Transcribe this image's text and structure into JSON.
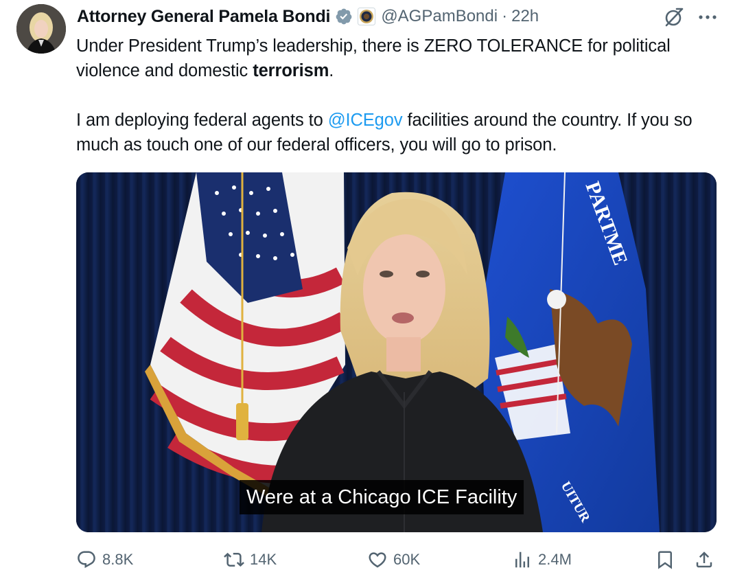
{
  "author": {
    "display_name": "Attorney General Pamela Bondi",
    "handle": "@AGPamBondi",
    "separator": "·",
    "time": "22h"
  },
  "icons": {
    "verified": "verified-badge-icon",
    "affiliate": "doj-seal-icon",
    "grok": "grok-icon",
    "more": "more-icon"
  },
  "tweet": {
    "line1_a": "Under President Trump’s leadership, there is ZERO TOLERANCE for political violence and domestic ",
    "line1_bold": "terrorism",
    "line1_end": ".",
    "line2_a": "I am deploying federal agents to ",
    "mention": "@ICEgov",
    "line2_b": " facilities around the country. If you so much as touch one of our federal officers, you will go to prison."
  },
  "media": {
    "caption": "Were at a Chicago ICE Facility",
    "seal_text": "PARTME",
    "seal_text_bottom": "UITUR"
  },
  "actions": {
    "replies": "8.8K",
    "reposts": "14K",
    "likes": "60K",
    "views": "2.4M"
  },
  "colors": {
    "accent": "#1d9bf0",
    "secondary_text": "#536471",
    "verified_blue": "#829aab"
  }
}
